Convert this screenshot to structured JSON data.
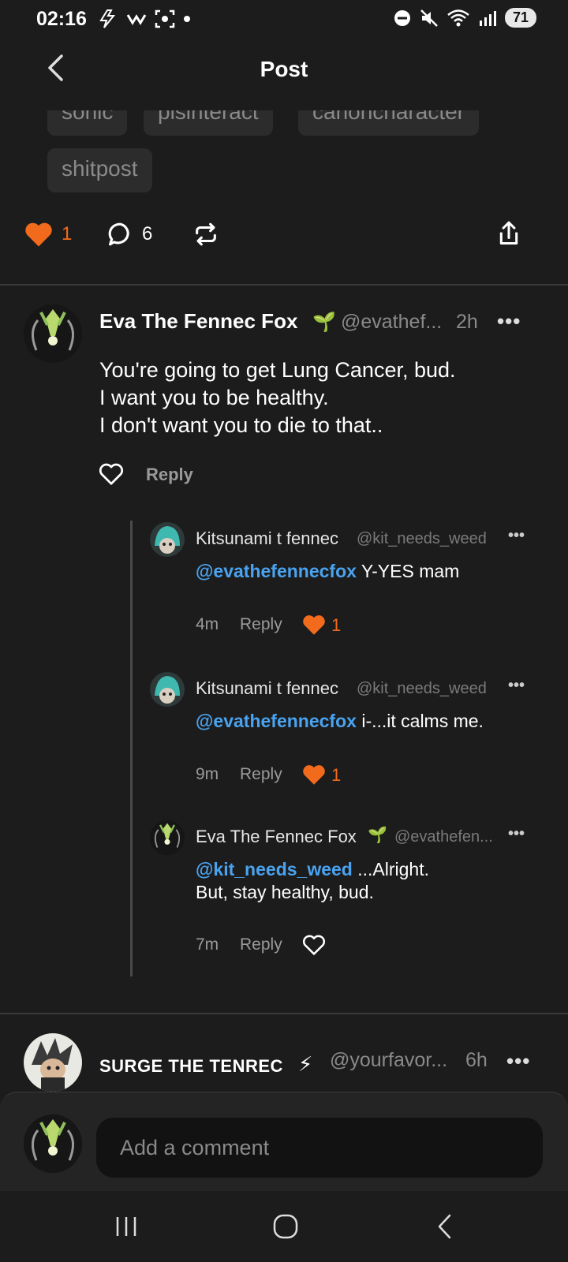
{
  "status_bar": {
    "time": "02:16",
    "battery": "71",
    "left_icons": [
      "flash-icon",
      "wifi-calling-icon",
      "screenshot-icon",
      "dot-icon"
    ],
    "right_icons": [
      "dnd-icon",
      "mute-icon",
      "wifi-icon",
      "signal-icon"
    ]
  },
  "header": {
    "title": "Post",
    "back_icon": "chevron-left-icon"
  },
  "tags": [
    "sonic",
    "pisinteract",
    "canoncharacter",
    "shitpost"
  ],
  "post_actions": {
    "like_count": "1",
    "comment_count": "6",
    "accent_color": "#f26a1b"
  },
  "comments": [
    {
      "name": "Eva The Fennec Fox",
      "badge": "🌱",
      "handle": "@evathef...",
      "time": "2h",
      "more": "•••",
      "body": "You're going to get Lung Cancer, bud.\nI want you to be healthy.\nI don't want you to die to that..",
      "reply_label": "Reply",
      "replies": [
        {
          "name": "Kitsunami t fennec",
          "handle": "@kit_needs_weed",
          "mention": "@evathefennecfox",
          "text": " Y-YES mam",
          "time": "4m",
          "reply_label": "Reply",
          "likes": "1",
          "liked": true
        },
        {
          "name": "Kitsunami t fennec",
          "handle": "@kit_needs_weed",
          "mention": "@evathefennecfox",
          "text": " i-...it calms me.",
          "time": "9m",
          "reply_label": "Reply",
          "likes": "1",
          "liked": true
        },
        {
          "name": "Eva The Fennec Fox",
          "badge": "🌱",
          "handle": "@evathefen...",
          "mention": "@kit_needs_weed",
          "text": " ...Alright.",
          "text2": "But, stay healthy, bud.",
          "time": "7m",
          "reply_label": "Reply",
          "liked": false
        }
      ]
    },
    {
      "name": "SURGE THE TENREC",
      "badge": "⚡",
      "handle": "@yourfavor...",
      "time": "6h",
      "more": "•••"
    }
  ],
  "composer": {
    "placeholder": "Add a comment"
  },
  "more_label": "•••"
}
